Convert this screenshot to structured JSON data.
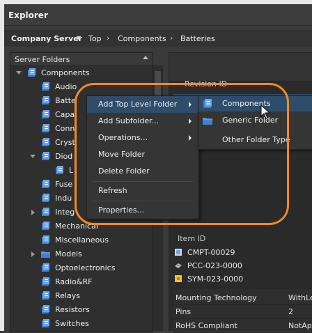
{
  "window": {
    "title": "Explorer"
  },
  "breadcrumb": {
    "server": "Company Server",
    "items": [
      "Top",
      "Components",
      "Batteries"
    ]
  },
  "left_pane": {
    "header": "Server Folders",
    "tree": [
      {
        "label": "Components",
        "expanded": true,
        "icon": "folder-library-icon"
      },
      {
        "label": "Audio",
        "icon": "folder-library-icon"
      },
      {
        "label": "Batte",
        "icon": "folder-library-icon",
        "selected": true
      },
      {
        "label": "Capa",
        "icon": "folder-library-icon"
      },
      {
        "label": "Conn",
        "icon": "folder-library-icon"
      },
      {
        "label": "Cryst",
        "icon": "folder-library-icon"
      },
      {
        "label": "Diod",
        "icon": "folder-library-icon"
      },
      {
        "label": "L",
        "icon": "folder-library-icon"
      },
      {
        "label": "Fuse",
        "icon": "folder-library-icon"
      },
      {
        "label": "Indu",
        "icon": "folder-library-icon"
      },
      {
        "label": "Integ",
        "icon": "folder-library-icon"
      },
      {
        "label": "Mechanical",
        "icon": "folder-library-icon"
      },
      {
        "label": "Miscellaneous",
        "icon": "folder-library-icon"
      },
      {
        "label": "Models",
        "icon": "folder-generic-icon"
      },
      {
        "label": "Optoelectronics",
        "icon": "folder-library-icon"
      },
      {
        "label": "Radio&RF",
        "icon": "folder-library-icon"
      },
      {
        "label": "Relays",
        "icon": "folder-library-icon"
      },
      {
        "label": "Resistors",
        "icon": "folder-library-icon"
      },
      {
        "label": "Switches",
        "icon": "folder-library-icon"
      }
    ]
  },
  "right_pane": {
    "revision_header": "Revision ID",
    "item_header": "Item ID",
    "items": [
      {
        "label": "CMPT-00029",
        "icon": "component-icon"
      },
      {
        "label": "PCC-023-0000",
        "icon": "footprint-icon"
      },
      {
        "label": "SYM-023-0000",
        "icon": "symbol-icon"
      }
    ],
    "properties": [
      {
        "key": "Mounting Technology",
        "value": "WithLe"
      },
      {
        "key": "Pins",
        "value": "2"
      },
      {
        "key": "RoHS Compliant",
        "value": "NotAp"
      }
    ]
  },
  "context_menu": {
    "items": [
      {
        "label": "Add Top Level Folder",
        "submenu": true,
        "highlighted": true
      },
      {
        "label": "Add Subfolder...",
        "submenu": true
      },
      {
        "label": "Operations...",
        "submenu": true
      },
      {
        "label": "Move Folder"
      },
      {
        "label": "Delete Folder"
      },
      {
        "label": "Refresh"
      },
      {
        "label": "Properties..."
      }
    ]
  },
  "submenu": {
    "items": [
      {
        "label": "Components",
        "icon": "folder-library-icon",
        "highlighted": true
      },
      {
        "label": "Generic Folder",
        "icon": "folder-generic-icon"
      },
      {
        "label": "Other Folder Type"
      }
    ]
  },
  "colors": {
    "highlight_ring": "#f08a24",
    "selection": "#2f4d6a",
    "folder_blue": "#4f8fd8"
  }
}
